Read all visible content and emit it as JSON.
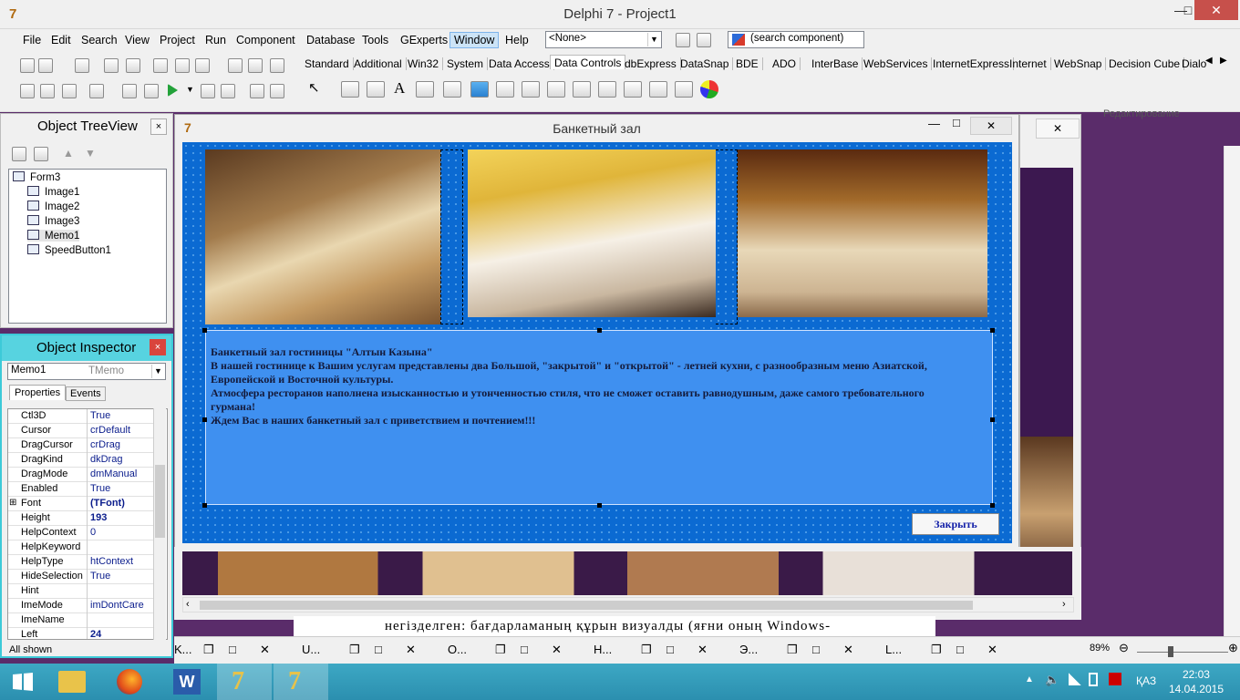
{
  "ide": {
    "title": "Delphi 7 - Project1",
    "menu": [
      "File",
      "Edit",
      "Search",
      "View",
      "Project",
      "Run",
      "Component",
      "Database",
      "Tools",
      "GExperts",
      "Window",
      "Help"
    ],
    "config_combo": "<None>",
    "search_component": "(search component)",
    "palette_tabs": [
      "Standard",
      "Additional",
      "Win32",
      "System",
      "Data Access",
      "Data Controls",
      "dbExpress",
      "DataSnap",
      "BDE",
      "ADO",
      "InterBase",
      "WebServices",
      "InternetExpress",
      "Internet",
      "WebSnap",
      "Decision Cube",
      "Dialo"
    ],
    "palette_selected": "Data Controls",
    "sub_toolbar_right": "Редактирование"
  },
  "treeview": {
    "title": "Object TreeView",
    "close": "×",
    "root": "Form3",
    "items": [
      "Image1",
      "Image2",
      "Image3",
      "Memo1",
      "SpeedButton1"
    ]
  },
  "inspector": {
    "title": "Object Inspector",
    "close": "×",
    "object_name": "Memo1",
    "object_type": "TMemo",
    "tabs": [
      "Properties",
      "Events"
    ],
    "properties": [
      {
        "name": "Ctl3D",
        "value": "True",
        "bold": false
      },
      {
        "name": "Cursor",
        "value": "crDefault",
        "bold": false
      },
      {
        "name": "DragCursor",
        "value": "crDrag",
        "bold": false
      },
      {
        "name": "DragKind",
        "value": "dkDrag",
        "bold": false
      },
      {
        "name": "DragMode",
        "value": "dmManual",
        "bold": false
      },
      {
        "name": "Enabled",
        "value": "True",
        "bold": false
      },
      {
        "name": "Font",
        "value": "(TFont)",
        "bold": true
      },
      {
        "name": "Height",
        "value": "193",
        "bold": true
      },
      {
        "name": "HelpContext",
        "value": "0",
        "bold": false
      },
      {
        "name": "HelpKeyword",
        "value": "",
        "bold": false
      },
      {
        "name": "HelpType",
        "value": "htContext",
        "bold": false
      },
      {
        "name": "HideSelection",
        "value": "True",
        "bold": false
      },
      {
        "name": "Hint",
        "value": "",
        "bold": false
      },
      {
        "name": "ImeMode",
        "value": "imDontCare",
        "bold": false
      },
      {
        "name": "ImeName",
        "value": "",
        "bold": false
      },
      {
        "name": "Left",
        "value": "24",
        "bold": true
      }
    ],
    "status": "All shown"
  },
  "form": {
    "title": "Банкетный зал",
    "memo_lines": [
      "Банкетный зал гостиницы \"Алтын Казына\"",
      "В нашей гостинице к Вашим услугам представлены два Большой, \"закрытой\" и \"открытой\" - летней кухни, с разнообразным меню Азиатской,",
      "Европейской и Восточной культуры.",
      "Атмосфера ресторанов наполнена изысканностью и утонченностью стиля, что не сможет оставить равнодушным, даже самого требовательного",
      "гурмана!",
      "Ждем Вас в наших банкетный зал с приветствием и почтением!!!"
    ],
    "close_button": "Закрыть"
  },
  "document": {
    "line": "негізделген:  бағдарламаның  құрын  визуалды  (яғни  оның  Windows-",
    "zoom": "89%"
  },
  "doc_tabs": [
    "K...",
    "U...",
    "O...",
    "H...",
    "Э...",
    "L..."
  ],
  "taskbar": {
    "lang": "ҚАЗ",
    "time": "22:03",
    "date": "14.04.2015"
  },
  "colors": {
    "form_blue": "#0b6ad2",
    "memo_blue": "#3f90f0",
    "inspector_accent": "#57d3e0",
    "taskbar": "#2b8faf"
  }
}
